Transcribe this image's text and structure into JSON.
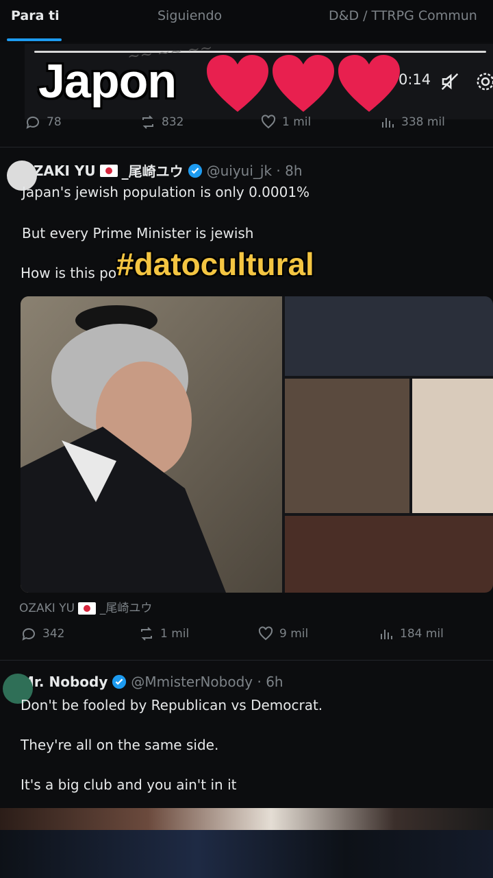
{
  "tabs": [
    {
      "label": "Para ti",
      "active": true
    },
    {
      "label": "Siguiendo",
      "active": false
    },
    {
      "label": "D&D / TTRPG Commun",
      "active": false
    }
  ],
  "overlay": {
    "title": "Japon",
    "hashtag": "#datocultural",
    "heart_color": "#e8204f",
    "hashtag_color": "#f4c542"
  },
  "video": {
    "time": "0:14",
    "mute_icon": "muted-speaker-icon",
    "settings_icon": "gear-icon"
  },
  "first_tweet_metrics": {
    "replies": "78",
    "reposts": "832",
    "likes": "1 mil",
    "views": "338 mil"
  },
  "tweet1": {
    "name": "OZAKI YU",
    "name_suffix": "_尾崎ユウ",
    "handle_time": "@uiyui_jk · 8h",
    "lines": [
      "Japan's jewish population is only 0.0001%",
      "But every Prime Minister is jewish",
      "How is this po"
    ],
    "caption": "OZAKI YU",
    "caption_suffix": "_尾崎ユウ",
    "metrics": {
      "replies": "342",
      "reposts": "1 mil",
      "likes": "9 mil",
      "views": "184 mil"
    }
  },
  "tweet2": {
    "name": "Mr. Nobody",
    "handle_time": "@MmisterNobody · 6h",
    "lines": [
      "Don't be fooled by Republican vs Democrat.",
      "They're all on the same side.",
      "It's a big club and you ain't in it"
    ]
  },
  "colors": {
    "accent": "#1d9bf0",
    "verified": "#1d9bf0",
    "muted_text": "#7d8388"
  }
}
